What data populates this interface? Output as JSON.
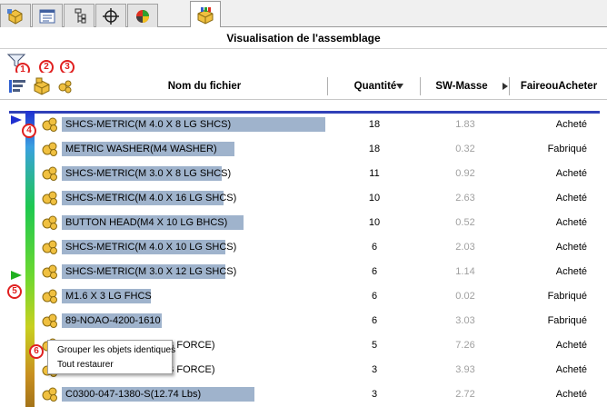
{
  "tabs": [
    {
      "icon": "feature-manager-icon",
      "active": false
    },
    {
      "icon": "property-manager-icon",
      "active": false
    },
    {
      "icon": "configuration-manager-icon",
      "active": false
    },
    {
      "icon": "dimxpert-icon",
      "active": false
    },
    {
      "icon": "display-manager-icon",
      "active": false
    },
    {
      "icon": "assembly-visualization-icon",
      "active": true
    }
  ],
  "panel_title": "Visualisation de l'assemblage",
  "callouts": [
    "1",
    "2",
    "3",
    "4",
    "5",
    "6"
  ],
  "columns": {
    "name": "Nom du fichier",
    "quantity": "Quantité",
    "mass": "SW-Masse",
    "make_buy": "FaireouAcheter"
  },
  "colors": {
    "selection": "#9fb3cc",
    "callout": "#e02020",
    "gradient_top": "#2030d0",
    "gradient_bottom": "#a07018",
    "marker_top": "#2030d0",
    "marker_mid": "#20b020"
  },
  "rows": [
    {
      "name": "SHCS-METRIC(M 4.0 X 8 LG SHCS)",
      "qty": "18",
      "mass": "1.83",
      "buy": "Acheté"
    },
    {
      "name": "METRIC WASHER(M4 WASHER)",
      "qty": "18",
      "mass": "0.32",
      "buy": "Fabriqué"
    },
    {
      "name": "SHCS-METRIC(M 3.0  X 8 LG SHCS)",
      "qty": "11",
      "mass": "0.92",
      "buy": "Acheté"
    },
    {
      "name": "SHCS-METRIC(M 4.0 X 16 LG SHCS)",
      "qty": "10",
      "mass": "2.63",
      "buy": "Acheté"
    },
    {
      "name": "BUTTON HEAD(M4 X 10 LG BHCS)",
      "qty": "10",
      "mass": "0.52",
      "buy": "Acheté"
    },
    {
      "name": "SHCS-METRIC(M 4.0 X 10 LG SHCS)",
      "qty": "6",
      "mass": "2.03",
      "buy": "Acheté"
    },
    {
      "name": "SHCS-METRIC(M 3.0  X 12 LG SHCS)",
      "qty": "6",
      "mass": "1.14",
      "buy": "Acheté"
    },
    {
      "name": "M1.6 X 3 LG FHCS",
      "qty": "6",
      "mass": "0.02",
      "buy": "Fabriqué"
    },
    {
      "name": "89-NOAO-4200-1610",
      "qty": "6",
      "mass": "3.03",
      "buy": "Fabriqué"
    },
    {
      "name": "B FORCE)",
      "qty": "5",
      "mass": "7.26",
      "buy": "Acheté"
    },
    {
      "name": "B FORCE)",
      "qty": "3",
      "mass": "3.93",
      "buy": "Acheté"
    },
    {
      "name": "C0300-047-1380-S(12.74 Lbs)",
      "qty": "3",
      "mass": "2.72",
      "buy": "Acheté"
    }
  ],
  "context_menu": [
    "Grouper les objets identiques",
    "Tout restaurer"
  ]
}
